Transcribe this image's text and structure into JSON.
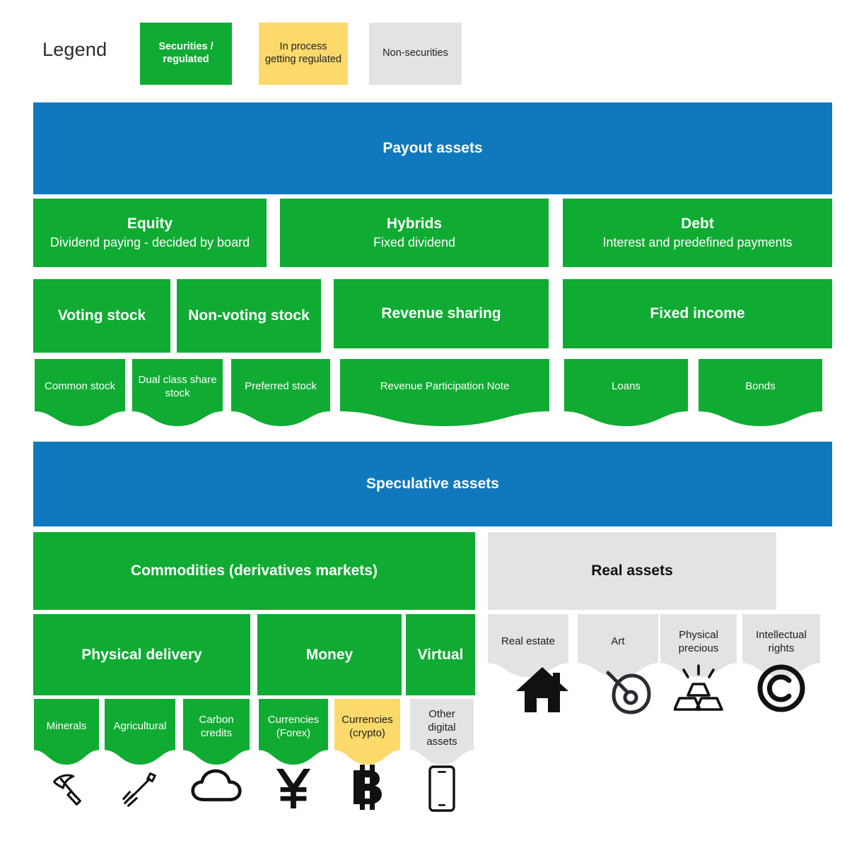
{
  "legend": {
    "label": "Legend",
    "items": [
      {
        "text": "Securities / regulated",
        "color": "#10ab33",
        "kind": "securities"
      },
      {
        "text": "In process getting regulated",
        "color": "#fbd96b",
        "kind": "in-process"
      },
      {
        "text": "Non-securities",
        "color": "#e3e3e3",
        "kind": "non-securities"
      }
    ]
  },
  "sections": [
    {
      "title": "Payout assets",
      "band_color": "#1079bd",
      "categories": [
        {
          "title": "Equity",
          "subtitle": "Dividend paying - decided by board"
        },
        {
          "title": "Hybrids",
          "subtitle": "Fixed dividend"
        },
        {
          "title": "Debt",
          "subtitle": "Interest and predefined payments"
        }
      ],
      "subcategories": [
        {
          "title": "Voting stock"
        },
        {
          "title": "Non-voting stock"
        },
        {
          "title": "Revenue sharing"
        },
        {
          "title": "Fixed income"
        }
      ],
      "leaves": [
        {
          "label": "Common stock",
          "kind": "securities"
        },
        {
          "label": "Dual class share stock",
          "kind": "securities"
        },
        {
          "label": "Preferred stock",
          "kind": "securities"
        },
        {
          "label": "Revenue Participation Note",
          "kind": "securities"
        },
        {
          "label": "Loans",
          "kind": "securities"
        },
        {
          "label": "Bonds",
          "kind": "securities"
        }
      ]
    },
    {
      "title": "Speculative assets",
      "band_color": "#1079bd",
      "categories": [
        {
          "title": "Commodities (derivatives markets)",
          "kind": "securities"
        },
        {
          "title": "Real assets",
          "kind": "non-securities"
        }
      ],
      "subcategories": [
        {
          "title": "Physical delivery"
        },
        {
          "title": "Money"
        },
        {
          "title": "Virtual"
        }
      ],
      "leaves": [
        {
          "label": "Minerals",
          "kind": "securities",
          "icon": "pickaxe-icon"
        },
        {
          "label": "Agricultural",
          "kind": "securities",
          "icon": "pitchfork-icon"
        },
        {
          "label": "Carbon credits",
          "kind": "securities",
          "icon": "cloud-icon"
        },
        {
          "label": "Currencies (Forex)",
          "kind": "securities",
          "icon": "yen-icon"
        },
        {
          "label": "Currencies (crypto)",
          "kind": "in-process",
          "icon": "bitcoin-icon"
        },
        {
          "label": "Other digital assets",
          "kind": "non-securities",
          "icon": "smartphone-icon"
        }
      ],
      "real_leaves": [
        {
          "label": "Real estate",
          "kind": "non-securities",
          "icon": "house-icon"
        },
        {
          "label": "Art",
          "kind": "non-securities",
          "icon": "palette-icon"
        },
        {
          "label": "Physical precious",
          "kind": "non-securities",
          "icon": "gold-bars-icon"
        },
        {
          "label": "Intellectual rights",
          "kind": "non-securities",
          "icon": "copyright-icon"
        }
      ]
    }
  ],
  "colors": {
    "green": "#10ab33",
    "yellow": "#fbd96b",
    "gray": "#e3e3e3",
    "blue": "#1079bd",
    "white": "#ffffff",
    "black": "#111111"
  }
}
